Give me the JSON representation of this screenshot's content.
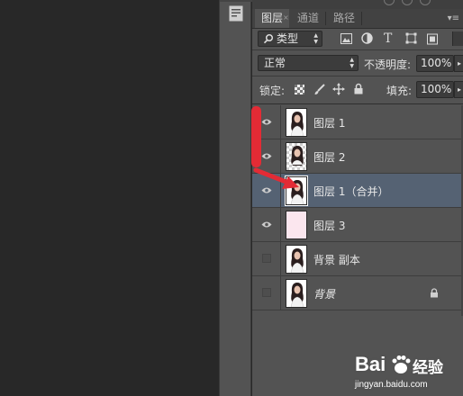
{
  "tabs": [
    {
      "label": "图层",
      "active": true
    },
    {
      "label": "通道",
      "active": false
    },
    {
      "label": "路径",
      "active": false
    }
  ],
  "panel_menu_icon": "panel-menu-icon",
  "filter": {
    "kind_label": "类型",
    "icons": [
      "image-filter-icon",
      "adjustment-filter-icon",
      "type-filter-icon",
      "shape-filter-icon",
      "smart-object-filter-icon"
    ]
  },
  "blend": {
    "mode": "正常",
    "opacity_label": "不透明度:",
    "opacity_value": "100%"
  },
  "lock": {
    "label": "锁定:",
    "icons": [
      "lock-transparent-icon",
      "lock-image-icon",
      "lock-position-icon",
      "lock-all-icon"
    ],
    "fill_label": "填充:",
    "fill_value": "100%"
  },
  "layers": [
    {
      "name": "图层 1",
      "visible": true,
      "thumb": "figure",
      "selected": false,
      "locked": false,
      "italic": false
    },
    {
      "name": "图层 2",
      "visible": true,
      "thumb": "figure-transparent",
      "selected": false,
      "locked": false,
      "italic": false
    },
    {
      "name": "图层 1（合并）",
      "visible": true,
      "thumb": "figure",
      "selected": true,
      "locked": false,
      "italic": false
    },
    {
      "name": "图层 3",
      "visible": true,
      "thumb": "pink",
      "selected": false,
      "locked": false,
      "italic": false
    },
    {
      "name": "背景 副本",
      "visible": false,
      "thumb": "figure",
      "selected": false,
      "locked": false,
      "italic": false
    },
    {
      "name": "背景",
      "visible": false,
      "thumb": "figure",
      "selected": false,
      "locked": true,
      "italic": true
    }
  ],
  "colors": {
    "panel_bg": "#535353",
    "selected_row": "#556273",
    "annotation_red": "#e32b35"
  },
  "watermark": {
    "brand": "Bai",
    "brand_suffix": "经验",
    "url": "jingyan.baidu.com"
  }
}
